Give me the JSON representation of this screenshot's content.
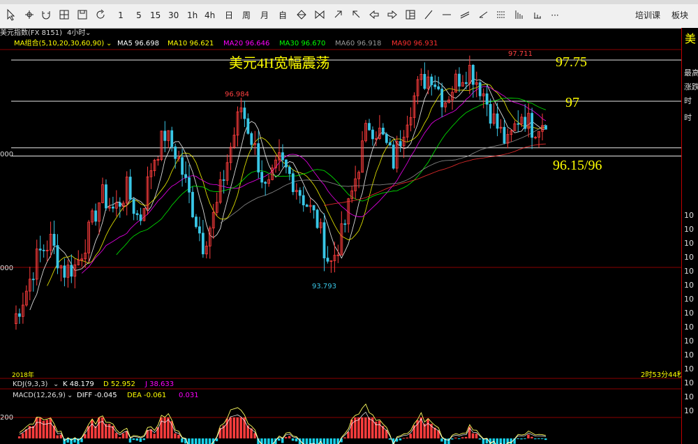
{
  "toolbar": {
    "periods": [
      "1",
      "5",
      "15",
      "30",
      "1h",
      "4h",
      "日",
      "周",
      "月",
      "自"
    ],
    "train_label": "培训课",
    "sector_label": "板块",
    "more_label": "···"
  },
  "infobar": {
    "instrument": "美元指数(FX 8151)",
    "period": "4小时"
  },
  "ma": {
    "group": "MA组合(5,10,20,30,60,90)",
    "items": [
      {
        "label": "MA5 96.698",
        "color": "#ffffff"
      },
      {
        "label": "MA10 96.621",
        "color": "#ffff00"
      },
      {
        "label": "MA20 96.646",
        "color": "#ff00ff"
      },
      {
        "label": "MA30 96.670",
        "color": "#00ff00"
      },
      {
        "label": "MA60 96.918",
        "color": "#999999"
      },
      {
        "label": "MA90 96.931",
        "color": "#ff3030"
      }
    ]
  },
  "annotations": {
    "title": "美元4H宽幅震荡",
    "level_1": "97.75",
    "level_2": "97",
    "level_3": "96.15/96",
    "high_main": "97.711",
    "high_left": "96.984",
    "low_mid": "93.793",
    "countdown": "2时53分44秒",
    "axis_label_mid": "000",
    "axis_label_low": "000",
    "axis_label_sub": "200",
    "axis_label_bottom": "2018年"
  },
  "kdj": {
    "label": "KDJ(9,3,3)",
    "k": "K 48.179",
    "d": "D 52.952",
    "j": "J 38.633"
  },
  "macd": {
    "label": "MACD(12,26,9)",
    "diff": "DIFF -0.045",
    "dea": "DEA -0.061",
    "macd": "0.031"
  },
  "right_panel": {
    "title": "美",
    "lines": [
      "最高",
      "涨跌",
      "时",
      "时",
      "10",
      "10",
      "10",
      "10",
      "10",
      "10",
      "10",
      "10",
      "10",
      "10",
      "10",
      "10",
      "10",
      "10",
      "10"
    ]
  },
  "chart_data": {
    "type": "candlestick",
    "instrument": "美元指数",
    "period": "4小时",
    "horizontal_levels": [
      97.75,
      97,
      96.15,
      96
    ],
    "extremes": [
      {
        "label": "97.711",
        "value": 97.711,
        "kind": "high"
      },
      {
        "label": "96.984",
        "value": 96.984,
        "kind": "high"
      },
      {
        "label": "93.793",
        "value": 93.793,
        "kind": "low"
      }
    ],
    "close_path": [
      92.95,
      93.5,
      94.2,
      94.45,
      93.9,
      94.0,
      94.6,
      95.3,
      95.0,
      95.4,
      94.8,
      95.9,
      96.4,
      96.0,
      95.2,
      94.4,
      95.0,
      96.0,
      96.9,
      96.2,
      95.3,
      95.9,
      95.6,
      95.2,
      94.8,
      94.0,
      94.6,
      95.6,
      96.6,
      96.4,
      95.9,
      96.7,
      97.3,
      97.5,
      97.0,
      97.4,
      97.6,
      97.2,
      96.6,
      96.2,
      96.8,
      96.5,
      96.7
    ],
    "colors": {
      "up": "#ff3d3d",
      "down": "#39c6e6",
      "level": "#e8e8e8",
      "annotation": "#ffff00",
      "grid": "#8b0000"
    }
  }
}
